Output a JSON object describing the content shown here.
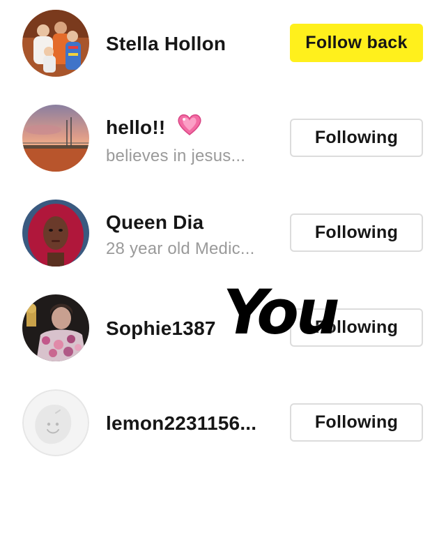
{
  "users": [
    {
      "name": "Stella Hollon",
      "bio": "",
      "button_label": "Follow back",
      "button_style": "follow-back",
      "avatar": "group-photo-avatar"
    },
    {
      "name": "hello!!",
      "emoji": "pink-sparkling-heart-icon",
      "bio": "believes in jesus...",
      "button_label": "Following",
      "button_style": "following",
      "avatar": "sunset-field-avatar"
    },
    {
      "name": "Queen Dia",
      "bio": "28 year old Medic...",
      "button_label": "Following",
      "button_style": "following",
      "avatar": "portrait-red-hair-avatar"
    },
    {
      "name": "Sophie1387",
      "bio": "",
      "button_label": "Following",
      "button_style": "following",
      "avatar": "floral-outfit-avatar"
    },
    {
      "name": "lemon2231156...",
      "bio": "",
      "button_label": "Following",
      "button_style": "following",
      "avatar": "default-ghost-avatar"
    }
  ],
  "watermark_text": "You",
  "colors": {
    "follow_back_bg": "#fff01c",
    "following_border": "#dcdcdc",
    "secondary_text": "#9a9a9a",
    "primary_text": "#161616"
  }
}
